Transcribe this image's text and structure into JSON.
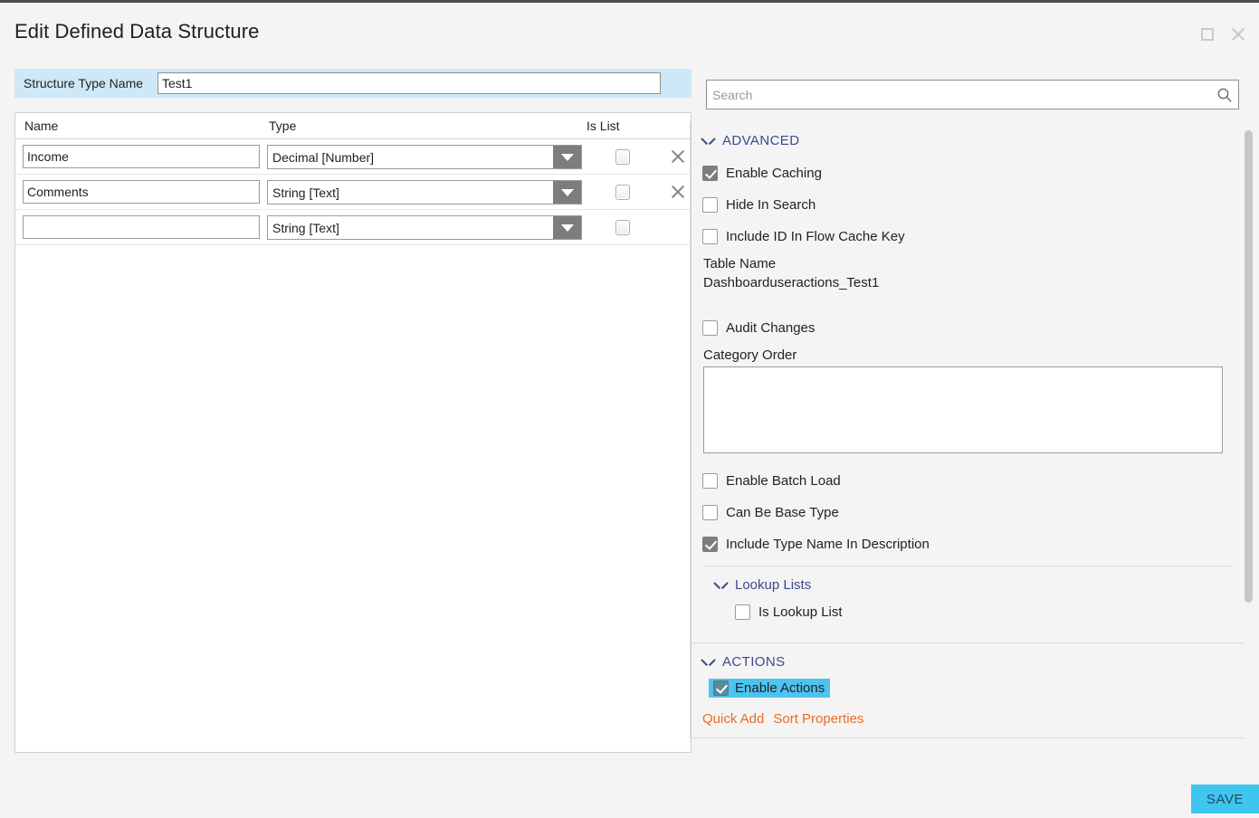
{
  "window": {
    "title": "Edit Defined Data Structure",
    "maximize_icon": "maximize-icon",
    "close_icon": "close-icon"
  },
  "structure": {
    "label": "Structure Type Name",
    "value": "Test1",
    "placeholder": ""
  },
  "grid": {
    "columns": [
      "Name",
      "Type",
      "Is List"
    ],
    "rows": [
      {
        "name": "Income",
        "type": "Decimal [Number]",
        "is_list": false,
        "removable": true
      },
      {
        "name": "Comments",
        "type": "String [Text]",
        "is_list": false,
        "removable": true
      },
      {
        "name": "",
        "type": "String [Text]",
        "is_list": false,
        "removable": false
      }
    ]
  },
  "search": {
    "value": "",
    "placeholder": "Search",
    "icon": "search-icon"
  },
  "advanced": {
    "title": "ADVANCED",
    "enable_caching": {
      "label": "Enable Caching",
      "checked": true
    },
    "hide_in_search": {
      "label": "Hide In Search",
      "checked": false
    },
    "include_id_in_flow_cache_key": {
      "label": "Include ID In Flow Cache Key",
      "checked": false
    },
    "table_name_label": "Table Name",
    "table_name_value": "Dashboarduseractions_Test1",
    "audit_changes": {
      "label": "Audit Changes",
      "checked": false
    },
    "category_order_label": "Category Order",
    "category_order_value": "",
    "enable_batch_load": {
      "label": "Enable Batch Load",
      "checked": false
    },
    "can_be_base_type": {
      "label": "Can Be Base Type",
      "checked": false
    },
    "include_type_name_in_description": {
      "label": "Include Type Name In Description",
      "checked": true
    },
    "lookup_lists": {
      "title": "Lookup Lists",
      "is_lookup_list": {
        "label": "Is Lookup List",
        "checked": false
      }
    }
  },
  "actions": {
    "title": "ACTIONS",
    "enable_actions": {
      "label": "Enable Actions",
      "checked": true,
      "highlighted": true
    },
    "quick_add": "Quick Add",
    "sort_properties": "Sort Properties"
  },
  "footer": {
    "save_label": "SAVE"
  },
  "colors": {
    "accent_blue": "#3ec6f0",
    "highlight_cyan": "#4ec3ef",
    "section_header": "#3b4a8f",
    "link_orange": "#ec6b28",
    "structure_row_bg": "#cfe8f7",
    "checkbox_checked": "#7d7d7d"
  }
}
